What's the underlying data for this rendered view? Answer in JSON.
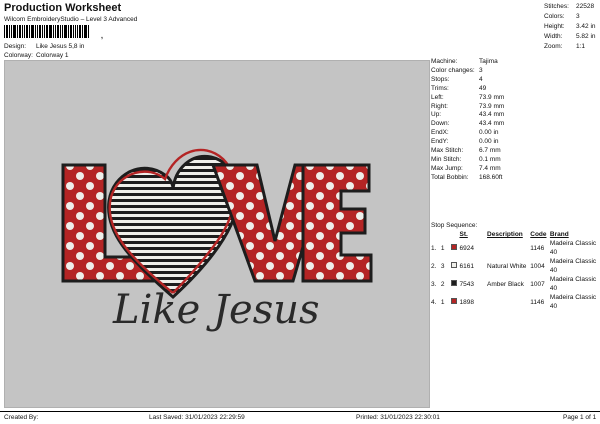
{
  "header": {
    "title": "Production Worksheet",
    "subtitle": "Wilcom EmbroideryStudio – Level 3 Advanced",
    "barcode_tick": ","
  },
  "design_info": [
    {
      "label": "Design:",
      "value": "Like Jesus 5,8 in"
    },
    {
      "label": "Colorway:",
      "value": "Colorway 1"
    }
  ],
  "summary": [
    {
      "label": "Stitches:",
      "value": "22528"
    },
    {
      "label": "Colors:",
      "value": "3"
    },
    {
      "label": "Height:",
      "value": "3.42 in"
    },
    {
      "label": "Width:",
      "value": "5.82 in"
    },
    {
      "label": "Zoom:",
      "value": "1:1"
    }
  ],
  "machine_details": [
    {
      "label": "Machine:",
      "value": "Tajima"
    },
    {
      "label": "Color changes:",
      "value": "3"
    },
    {
      "label": "Stops:",
      "value": "4"
    },
    {
      "label": "Trims:",
      "value": "49"
    },
    {
      "label": "Left:",
      "value": "73.9 mm"
    },
    {
      "label": "Right:",
      "value": "73.9 mm"
    },
    {
      "label": "Up:",
      "value": "43.4 mm"
    },
    {
      "label": "Down:",
      "value": "43.4 mm"
    },
    {
      "label": "EndX:",
      "value": "0.00 in"
    },
    {
      "label": "EndY:",
      "value": "0.00 in"
    },
    {
      "label": "Max Stitch:",
      "value": "6.7 mm"
    },
    {
      "label": "Min Stitch:",
      "value": "0.1 mm"
    },
    {
      "label": "Max Jump:",
      "value": "7.4 mm"
    },
    {
      "label": "Total Bobbin:",
      "value": "168.60ft"
    }
  ],
  "stop_sequence": {
    "title": "Stop Sequence:",
    "headers": {
      "st": "St.",
      "description": "Description",
      "code": "Code",
      "brand": "Brand"
    },
    "rows": [
      {
        "stop": "1.",
        "color_no": "1",
        "swatch": "#b42525",
        "st": "6924",
        "description": "",
        "code": "1146",
        "brand": "Madeira Classic 40"
      },
      {
        "stop": "2.",
        "color_no": "3",
        "swatch": "#efefea",
        "st": "6161",
        "description": "Natural White",
        "code": "1004",
        "brand": "Madeira Classic 40"
      },
      {
        "stop": "3.",
        "color_no": "2",
        "swatch": "#1d1d1d",
        "st": "7543",
        "description": "Amber Black",
        "code": "1007",
        "brand": "Madeira Classic 40"
      },
      {
        "stop": "4.",
        "color_no": "1",
        "swatch": "#b42525",
        "st": "1898",
        "description": "",
        "code": "1146",
        "brand": "Madeira Classic 40"
      }
    ]
  },
  "design_text": {
    "word_main": "LOVE",
    "word_script": "Like Jesus"
  },
  "colors": {
    "canvas_bg": "#c4c4c4",
    "red": "#b42525",
    "white": "#efefea",
    "black": "#1d1d1d"
  },
  "footer": {
    "created_by": "Created By:",
    "last_saved": "Last Saved: 31/01/2023 22:29:59",
    "printed": "Printed: 31/01/2023 22:30:01",
    "page": "Page 1 of 1"
  }
}
